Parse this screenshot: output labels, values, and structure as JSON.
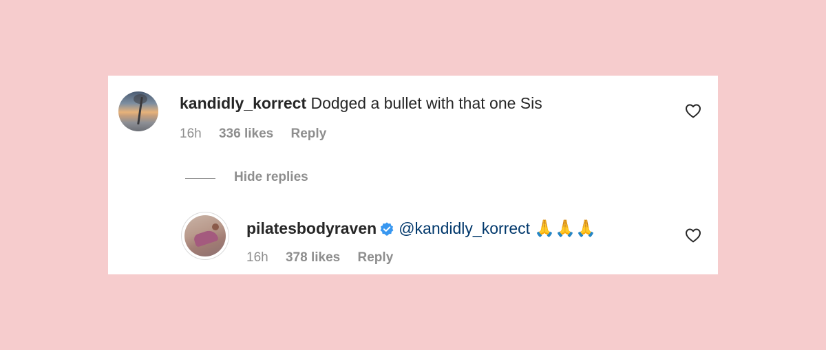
{
  "comment": {
    "username": "kandidly_korrect",
    "text": "Dodged a bullet with that one Sis",
    "time": "16h",
    "likes": "336 likes",
    "reply_label": "Reply"
  },
  "hide_replies_label": "Hide replies",
  "reply": {
    "username": "pilatesbodyraven",
    "mention": "@kandidly_korrect",
    "emoji": "🙏🙏🙏",
    "time": "16h",
    "likes": "378 likes",
    "reply_label": "Reply"
  },
  "colors": {
    "background": "#f6cccd",
    "verified": "#3897f0",
    "mention": "#00376b",
    "muted": "#8e8e8e"
  },
  "icons": [
    "heart-icon",
    "verified-badge-icon"
  ]
}
